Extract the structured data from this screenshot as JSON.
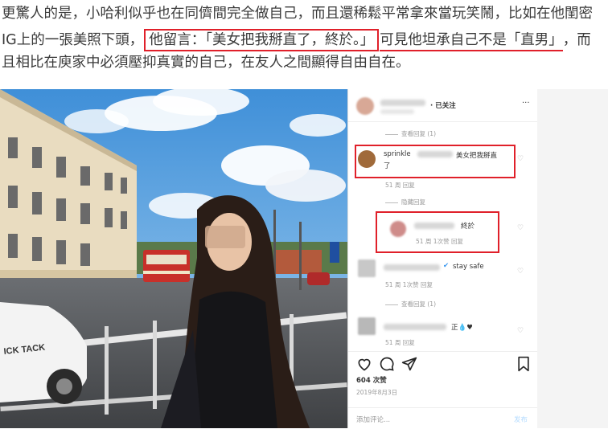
{
  "article": {
    "line1": "更驚人的是，小哈利似乎也在同儕間完全做自己，而且還稀鬆平常拿來當玩笑鬧，比如在他閨密",
    "line2_pre": "IG上的一張美照下頭，",
    "line2_boxed": "他留言：「美女把我掰直了，終於。」",
    "line2_underlined": "可見他坦承自己不是「直男」",
    "line2_post": "，而",
    "line3": "且相比在庾家中必須壓抑真實的自己，在友人之間顯得自由自在。"
  },
  "instagram": {
    "header": {
      "follow_status": "· 已关注",
      "more": "···"
    },
    "view_replies_1": "查看回复 (1)",
    "comment1": {
      "user": "sprinkle",
      "text": "美女把我掰直",
      "text2": "了",
      "meta": "51 周    回复"
    },
    "hide_replies": "隐藏回复",
    "reply1": {
      "text": "終於",
      "meta": "51 周    1次赞    回复"
    },
    "comment2": {
      "text": "stay safe",
      "meta": "51 周    1次赞    回复"
    },
    "view_replies_2": "查看回复 (1)",
    "comment3": {
      "text": "正💧♥",
      "meta": "51 周    回复"
    },
    "likes": "604 次赞",
    "date": "2019年8月3日",
    "add_comment_placeholder": "添加评论...",
    "post_button": "发布"
  },
  "colors": {
    "highlight": "#e0202a",
    "verified": "#3897f0"
  },
  "icons": [
    "heart-icon",
    "comment-icon",
    "share-icon",
    "bookmark-icon",
    "more-icon",
    "verified-icon"
  ]
}
